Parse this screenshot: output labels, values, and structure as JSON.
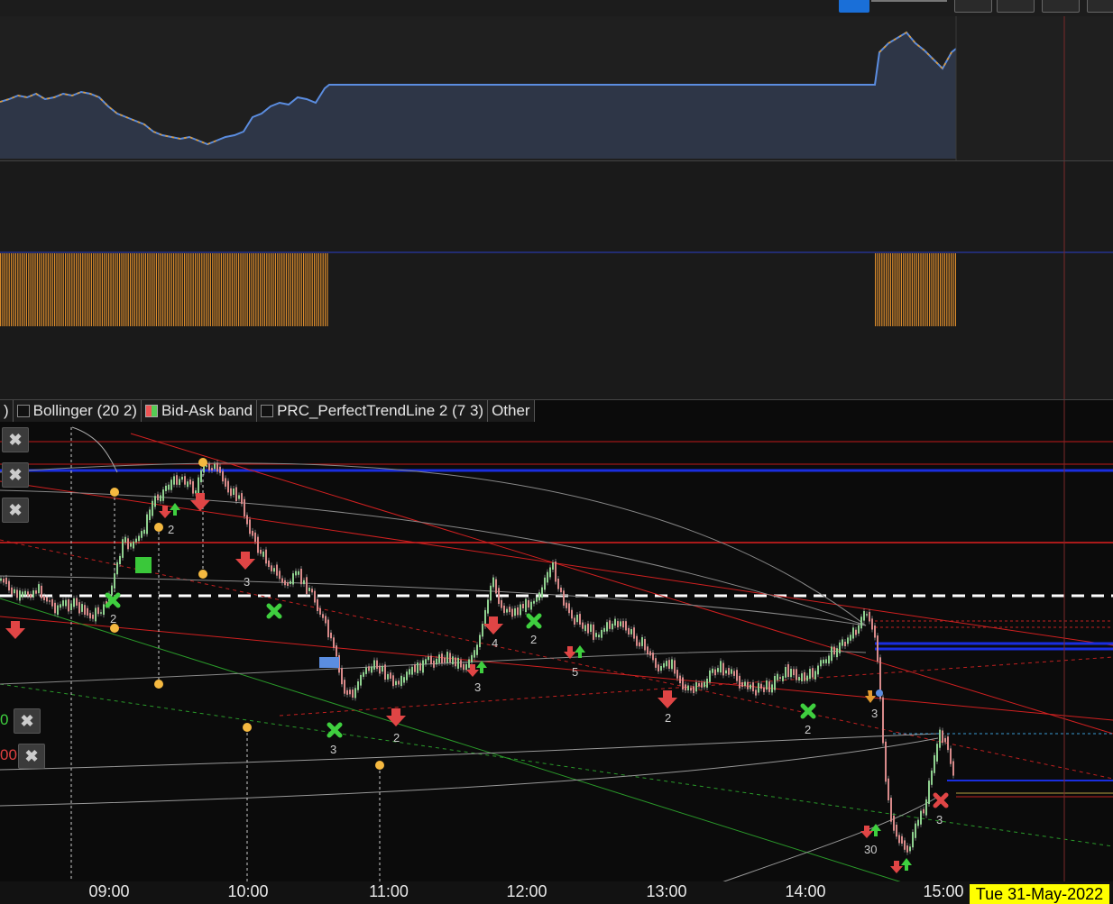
{
  "toolbar": {
    "icons": [
      "blue-tool-icon",
      "window-layout-icon-1",
      "window-layout-icon-2",
      "window-layout-icon-3",
      "window-layout-icon-4"
    ]
  },
  "legend": {
    "items": [
      {
        "label": ")",
        "checkbox": false
      },
      {
        "label": "Bollinger (20 2)",
        "checkbox": true,
        "style": "empty"
      },
      {
        "label": "Bid-Ask band",
        "checkbox": true,
        "style": "red-green"
      },
      {
        "label": "PRC_PerfectTrendLine 2 (7 3)",
        "checkbox": true,
        "style": "empty"
      },
      {
        "label": "Other",
        "checkbox": false
      }
    ]
  },
  "left_labels": [
    {
      "text": "0",
      "color": "#3fcf3f"
    },
    {
      "text": "00",
      "color": "#e04040"
    }
  ],
  "colors": {
    "price_line": "#5b8de0",
    "price_fill": "#2e3647",
    "price_orange": "#e39a2e",
    "histogram": "#d98a2b",
    "up_candle": "#8fd08f",
    "down_candle": "#d88a8a",
    "resistance": "#e02020",
    "support_blue": "#1a2ee0",
    "trend_green": "#2a9a2a",
    "white_dash": "#ffffff",
    "signal_up": "#3fcf3f",
    "signal_down": "#e04545",
    "dot": "#f5b940",
    "date_bg": "#ffff00"
  },
  "signal_labels": {
    "s1": "2",
    "s2": "2",
    "s3": "3",
    "s4": "3",
    "s5": "2",
    "s6": "4",
    "s7": "2",
    "s8": "3",
    "s9": "5",
    "s10": "2",
    "s11": "2",
    "s12": "3",
    "s13": "30",
    "s14": "3"
  },
  "chart_data": {
    "type": "line",
    "x_ticks": [
      "09:00",
      "10:00",
      "11:00",
      "12:00",
      "13:00",
      "14:00",
      "15:00"
    ],
    "date_label": "Tue 31-May-2022",
    "panes": [
      "price-line",
      "histogram",
      "candlestick"
    ],
    "grid": false
  }
}
